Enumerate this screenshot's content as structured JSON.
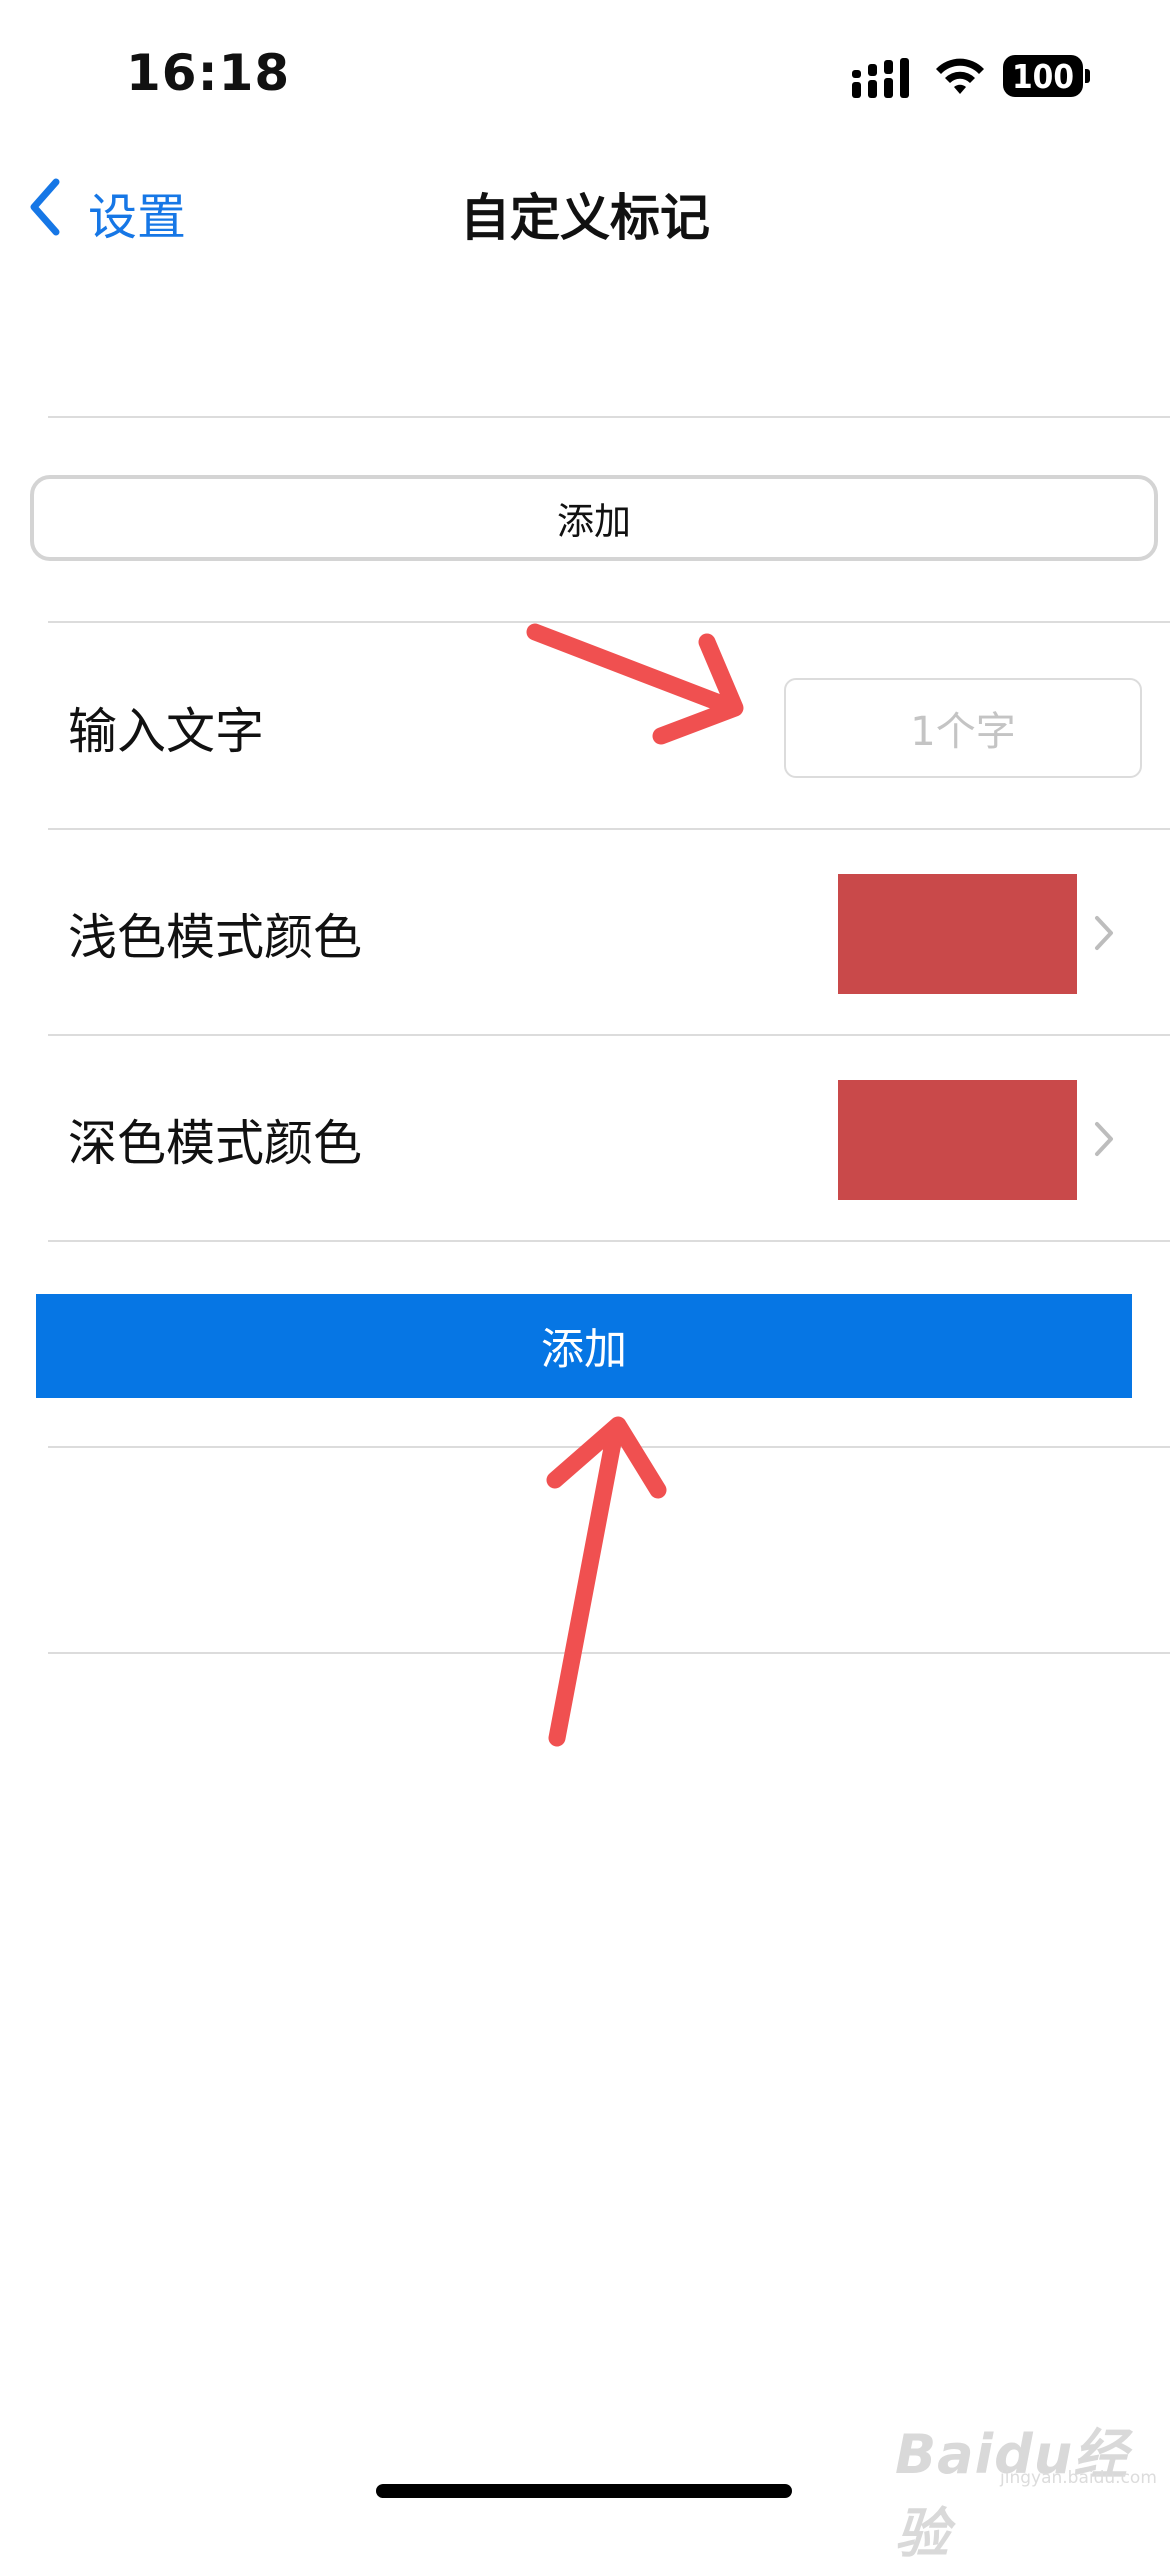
{
  "status_bar": {
    "time": "16:18",
    "battery": "100"
  },
  "nav": {
    "back_label": "设置",
    "title": "自定义标记"
  },
  "top_button": {
    "label": "添加"
  },
  "rows": [
    {
      "label": "输入文字",
      "placeholder": "1个字"
    },
    {
      "label": "浅色模式颜色",
      "color": "#c9494a"
    },
    {
      "label": "深色模式颜色",
      "color": "#c9494a"
    }
  ],
  "primary_button": {
    "label": "添加",
    "color": "#0676e4"
  },
  "accent_color": "#1677e6",
  "annotation_color": "#f05050",
  "watermark": {
    "brand": "Baidu经验",
    "url": "jingyan.baidu.com"
  }
}
